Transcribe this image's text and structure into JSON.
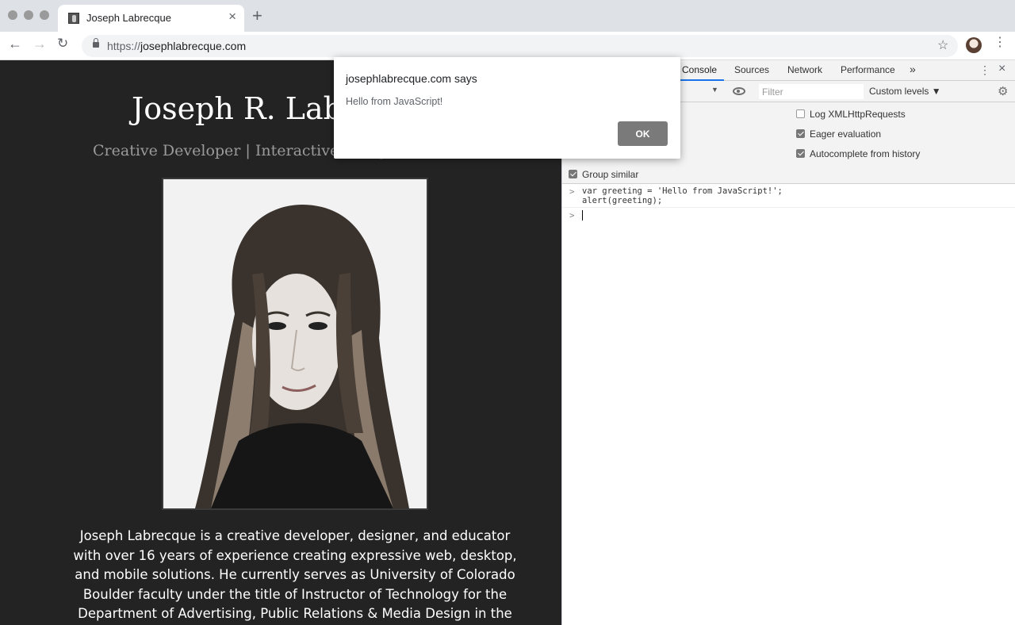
{
  "browser": {
    "tab_title": "Joseph Labrecque",
    "url_scheme": "https://",
    "url_host": "josephlabrecque.com"
  },
  "page": {
    "site_title": "Joseph R. Labrecque",
    "site_subtitle": "Creative Developer | Interactive Designer",
    "bio": "Joseph Labrecque is a creative developer, designer, and educator with over 16 years of experience creating expressive web, desktop, and mobile solutions. He currently serves as University of Colorado Boulder faculty under the title of Instructor of Technology for the Department of Advertising, Public Relations & Media Design in the College of Media,"
  },
  "devtools": {
    "tabs": [
      {
        "label": "Console",
        "active": true
      },
      {
        "label": "Sources",
        "active": false
      },
      {
        "label": "Network",
        "active": false
      },
      {
        "label": "Performance",
        "active": false
      }
    ],
    "more_tabs": "»",
    "filter_placeholder": "Filter",
    "levels_label": "Custom levels ▼",
    "settings": [
      {
        "label": "Log XMLHttpRequests",
        "checked": false
      },
      {
        "label": "Eager evaluation",
        "checked": true
      },
      {
        "label": "Autocomplete from history",
        "checked": true
      },
      {
        "label": "Group similar",
        "checked": true
      }
    ],
    "console": {
      "executed_code": "var greeting = 'Hello from JavaScript!';\nalert(greeting);",
      "prompt_symbol": ">"
    }
  },
  "alert": {
    "title": "josephlabrecque.com says",
    "message": "Hello from JavaScript!",
    "ok_label": "OK"
  },
  "icons": {
    "back": "arrow-left",
    "forward": "arrow-right",
    "reload": "reload",
    "bookmark": "star",
    "menu": "kebab",
    "devtools_settings": "gear",
    "live_expression": "eye"
  }
}
